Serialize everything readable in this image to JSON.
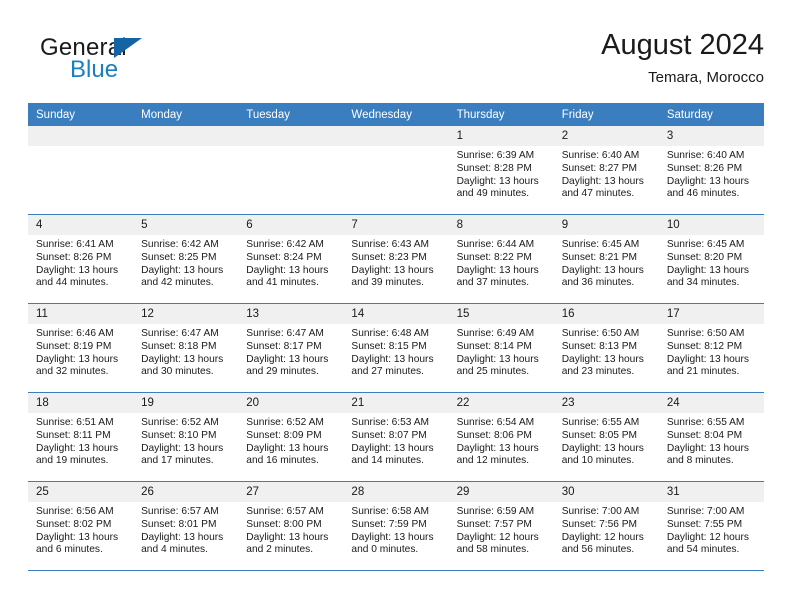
{
  "brand": {
    "line1": "General",
    "line2": "Blue",
    "triangle_color": "#1464a5",
    "blue_color": "#1a7fc1"
  },
  "header": {
    "title": "August 2024",
    "subtitle": "Temara, Morocco"
  },
  "theme": {
    "header_blue": "#3a7ec0",
    "daynum_band": "#f0f0f0"
  },
  "weekday_headers": [
    "Sunday",
    "Monday",
    "Tuesday",
    "Wednesday",
    "Thursday",
    "Friday",
    "Saturday"
  ],
  "labels": {
    "sunrise_prefix": "Sunrise:",
    "sunset_prefix": "Sunset:",
    "daylight_prefix": "Daylight:"
  },
  "weeks": [
    [
      {
        "day": "",
        "sunrise": "",
        "sunset": "",
        "daylight": "",
        "empty": true
      },
      {
        "day": "",
        "sunrise": "",
        "sunset": "",
        "daylight": "",
        "empty": true
      },
      {
        "day": "",
        "sunrise": "",
        "sunset": "",
        "daylight": "",
        "empty": true
      },
      {
        "day": "",
        "sunrise": "",
        "sunset": "",
        "daylight": "",
        "empty": true
      },
      {
        "day": "1",
        "sunrise": "Sunrise: 6:39 AM",
        "sunset": "Sunset: 8:28 PM",
        "daylight": "Daylight: 13 hours and 49 minutes.",
        "empty": false
      },
      {
        "day": "2",
        "sunrise": "Sunrise: 6:40 AM",
        "sunset": "Sunset: 8:27 PM",
        "daylight": "Daylight: 13 hours and 47 minutes.",
        "empty": false
      },
      {
        "day": "3",
        "sunrise": "Sunrise: 6:40 AM",
        "sunset": "Sunset: 8:26 PM",
        "daylight": "Daylight: 13 hours and 46 minutes.",
        "empty": false
      }
    ],
    [
      {
        "day": "4",
        "sunrise": "Sunrise: 6:41 AM",
        "sunset": "Sunset: 8:26 PM",
        "daylight": "Daylight: 13 hours and 44 minutes.",
        "empty": false
      },
      {
        "day": "5",
        "sunrise": "Sunrise: 6:42 AM",
        "sunset": "Sunset: 8:25 PM",
        "daylight": "Daylight: 13 hours and 42 minutes.",
        "empty": false
      },
      {
        "day": "6",
        "sunrise": "Sunrise: 6:42 AM",
        "sunset": "Sunset: 8:24 PM",
        "daylight": "Daylight: 13 hours and 41 minutes.",
        "empty": false
      },
      {
        "day": "7",
        "sunrise": "Sunrise: 6:43 AM",
        "sunset": "Sunset: 8:23 PM",
        "daylight": "Daylight: 13 hours and 39 minutes.",
        "empty": false
      },
      {
        "day": "8",
        "sunrise": "Sunrise: 6:44 AM",
        "sunset": "Sunset: 8:22 PM",
        "daylight": "Daylight: 13 hours and 37 minutes.",
        "empty": false
      },
      {
        "day": "9",
        "sunrise": "Sunrise: 6:45 AM",
        "sunset": "Sunset: 8:21 PM",
        "daylight": "Daylight: 13 hours and 36 minutes.",
        "empty": false
      },
      {
        "day": "10",
        "sunrise": "Sunrise: 6:45 AM",
        "sunset": "Sunset: 8:20 PM",
        "daylight": "Daylight: 13 hours and 34 minutes.",
        "empty": false
      }
    ],
    [
      {
        "day": "11",
        "sunrise": "Sunrise: 6:46 AM",
        "sunset": "Sunset: 8:19 PM",
        "daylight": "Daylight: 13 hours and 32 minutes.",
        "empty": false
      },
      {
        "day": "12",
        "sunrise": "Sunrise: 6:47 AM",
        "sunset": "Sunset: 8:18 PM",
        "daylight": "Daylight: 13 hours and 30 minutes.",
        "empty": false
      },
      {
        "day": "13",
        "sunrise": "Sunrise: 6:47 AM",
        "sunset": "Sunset: 8:17 PM",
        "daylight": "Daylight: 13 hours and 29 minutes.",
        "empty": false
      },
      {
        "day": "14",
        "sunrise": "Sunrise: 6:48 AM",
        "sunset": "Sunset: 8:15 PM",
        "daylight": "Daylight: 13 hours and 27 minutes.",
        "empty": false
      },
      {
        "day": "15",
        "sunrise": "Sunrise: 6:49 AM",
        "sunset": "Sunset: 8:14 PM",
        "daylight": "Daylight: 13 hours and 25 minutes.",
        "empty": false
      },
      {
        "day": "16",
        "sunrise": "Sunrise: 6:50 AM",
        "sunset": "Sunset: 8:13 PM",
        "daylight": "Daylight: 13 hours and 23 minutes.",
        "empty": false
      },
      {
        "day": "17",
        "sunrise": "Sunrise: 6:50 AM",
        "sunset": "Sunset: 8:12 PM",
        "daylight": "Daylight: 13 hours and 21 minutes.",
        "empty": false
      }
    ],
    [
      {
        "day": "18",
        "sunrise": "Sunrise: 6:51 AM",
        "sunset": "Sunset: 8:11 PM",
        "daylight": "Daylight: 13 hours and 19 minutes.",
        "empty": false
      },
      {
        "day": "19",
        "sunrise": "Sunrise: 6:52 AM",
        "sunset": "Sunset: 8:10 PM",
        "daylight": "Daylight: 13 hours and 17 minutes.",
        "empty": false
      },
      {
        "day": "20",
        "sunrise": "Sunrise: 6:52 AM",
        "sunset": "Sunset: 8:09 PM",
        "daylight": "Daylight: 13 hours and 16 minutes.",
        "empty": false
      },
      {
        "day": "21",
        "sunrise": "Sunrise: 6:53 AM",
        "sunset": "Sunset: 8:07 PM",
        "daylight": "Daylight: 13 hours and 14 minutes.",
        "empty": false
      },
      {
        "day": "22",
        "sunrise": "Sunrise: 6:54 AM",
        "sunset": "Sunset: 8:06 PM",
        "daylight": "Daylight: 13 hours and 12 minutes.",
        "empty": false
      },
      {
        "day": "23",
        "sunrise": "Sunrise: 6:55 AM",
        "sunset": "Sunset: 8:05 PM",
        "daylight": "Daylight: 13 hours and 10 minutes.",
        "empty": false
      },
      {
        "day": "24",
        "sunrise": "Sunrise: 6:55 AM",
        "sunset": "Sunset: 8:04 PM",
        "daylight": "Daylight: 13 hours and 8 minutes.",
        "empty": false
      }
    ],
    [
      {
        "day": "25",
        "sunrise": "Sunrise: 6:56 AM",
        "sunset": "Sunset: 8:02 PM",
        "daylight": "Daylight: 13 hours and 6 minutes.",
        "empty": false
      },
      {
        "day": "26",
        "sunrise": "Sunrise: 6:57 AM",
        "sunset": "Sunset: 8:01 PM",
        "daylight": "Daylight: 13 hours and 4 minutes.",
        "empty": false
      },
      {
        "day": "27",
        "sunrise": "Sunrise: 6:57 AM",
        "sunset": "Sunset: 8:00 PM",
        "daylight": "Daylight: 13 hours and 2 minutes.",
        "empty": false
      },
      {
        "day": "28",
        "sunrise": "Sunrise: 6:58 AM",
        "sunset": "Sunset: 7:59 PM",
        "daylight": "Daylight: 13 hours and 0 minutes.",
        "empty": false
      },
      {
        "day": "29",
        "sunrise": "Sunrise: 6:59 AM",
        "sunset": "Sunset: 7:57 PM",
        "daylight": "Daylight: 12 hours and 58 minutes.",
        "empty": false
      },
      {
        "day": "30",
        "sunrise": "Sunrise: 7:00 AM",
        "sunset": "Sunset: 7:56 PM",
        "daylight": "Daylight: 12 hours and 56 minutes.",
        "empty": false
      },
      {
        "day": "31",
        "sunrise": "Sunrise: 7:00 AM",
        "sunset": "Sunset: 7:55 PM",
        "daylight": "Daylight: 12 hours and 54 minutes.",
        "empty": false
      }
    ]
  ]
}
